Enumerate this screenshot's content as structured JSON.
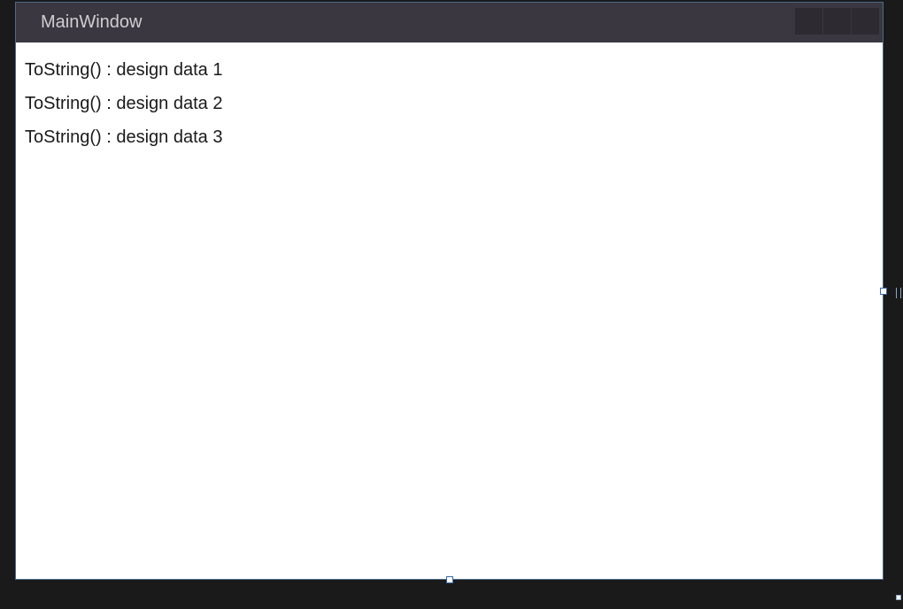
{
  "window": {
    "title": "MainWindow"
  },
  "items": [
    {
      "label": "ToString() : design data 1"
    },
    {
      "label": "ToString() : design data 2"
    },
    {
      "label": "ToString() : design data 3"
    }
  ]
}
